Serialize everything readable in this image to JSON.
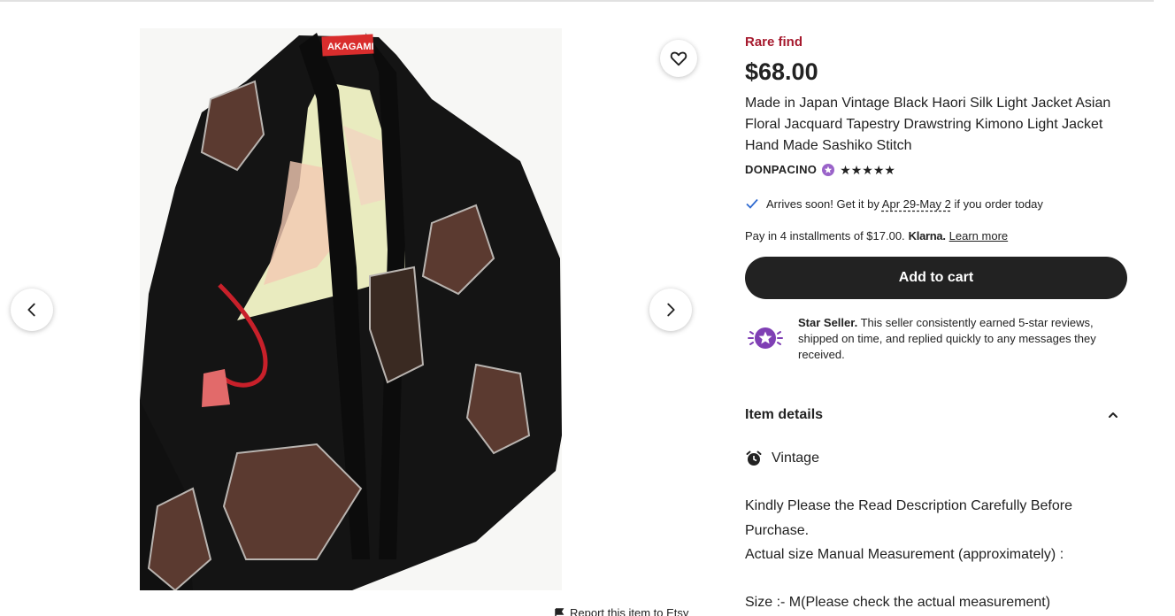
{
  "gallery": {
    "label_tag": "AKAGAMI",
    "prev_icon": "chevron-left-icon",
    "next_icon": "chevron-right-icon",
    "favorite_icon": "heart-icon"
  },
  "report": {
    "label": "Report this item to Etsy",
    "icon": "flag-icon"
  },
  "listing": {
    "rare_find": "Rare find",
    "price": "$68.00",
    "title": "Made in Japan Vintage Black Haori Silk Light Jacket Asian Floral Jacquard Tapestry Drawstring Kimono Light Jacket Hand Made Sashiko Stitch",
    "shop_name": "DONPACINO",
    "rating_stars": 5,
    "stars_text": "★★★★★",
    "arrives_prefix": "Arrives soon! Get it by",
    "arrives_dates": "Apr 29-May 2",
    "arrives_suffix": "if you order today",
    "installments_text": "Pay in 4 installments of $17.00.",
    "klarna": "Klarna.",
    "learn_more": "Learn more",
    "add_to_cart": "Add to cart",
    "star_seller_title": "Star Seller.",
    "star_seller_text": "This seller consistently earned 5-star reviews, shipped on time, and replied quickly to any messages they received.",
    "item_details_label": "Item details",
    "vintage_label": "Vintage",
    "description": [
      "Kindly Please the Read Description Carefully Before Purchase.",
      "Actual size Manual Measurement (approximately) :",
      "Size :- M(Please check the actual measurement)"
    ]
  },
  "colors": {
    "rare_find": "#a61a2e",
    "button_bg": "#222222",
    "star_seller_purple": "#7f3fb4",
    "check_blue": "#2f6ad0"
  }
}
